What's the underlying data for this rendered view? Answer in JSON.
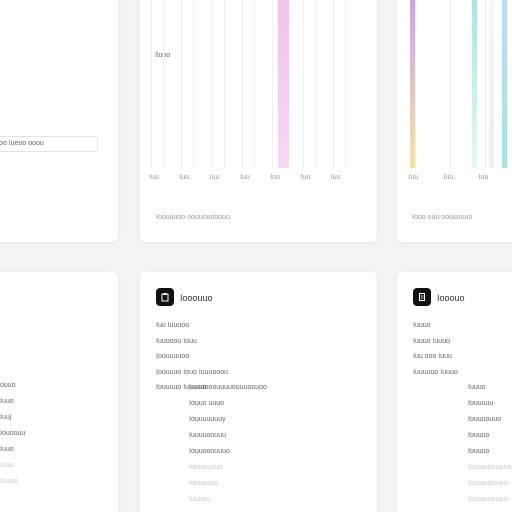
{
  "colors": {
    "background": "#f3f3f4",
    "card": "#ffffff",
    "accent_pink": "#f1c4ec",
    "accent_purple": "#b38be3",
    "accent_teal": "#a8e6e0",
    "accent_yellow": "#f2e6a6",
    "accent_blue": "#bcdcf2",
    "icon_dark": "#111111"
  },
  "left_top_card": {
    "filter_value": "oo Iueoo ooou"
  },
  "chart_card_1": {
    "label_top": "Iluoo",
    "footer": "Iouuuuoo oouuouooouo"
  },
  "chart_card_2": {
    "footer": "Iooo ouu oouuuouo"
  },
  "chart_data": [
    {
      "type": "bar",
      "categories": [
        "Iuu",
        "Iuu",
        "Iuu",
        "Iuu",
        "Iuu",
        "Iuu",
        "Iuu"
      ],
      "series": [
        {
          "values": [
            0,
            0,
            0,
            0,
            1,
            0,
            0
          ]
        }
      ]
    },
    {
      "type": "bar",
      "categories": [
        "Iuu",
        "Iuu",
        "Iuu"
      ],
      "series": [
        {
          "values": [
            1,
            0,
            1,
            1,
            1,
            1
          ]
        }
      ]
    }
  ],
  "left_bottom_card": {
    "items": [
      "ouuo",
      "Iuuo",
      "Iuuj",
      "Iouoouu",
      "Iuuo",
      "Iouu",
      "Iuuuo"
    ]
  },
  "panel_1": {
    "title": "Iooouuo",
    "rows": [
      "Iuu Iuuuoo",
      "Iuuooou Iouu",
      "Iouuuuuoo",
      "Iouuuuo Iouo Iuuuooou",
      "Iouuuuo Iuuuuuooouuuuouuuoouoo"
    ],
    "sub_rows": [
      "Iuuuo",
      "Iouuo uuuo",
      "Iouuuuuuuy",
      "Iuuuuoouuu",
      "Iouuooouuuo",
      "Iouuuuuuo",
      "Iouuuooo",
      "Iuuuuu"
    ]
  },
  "panel_2": {
    "title": "Iooouo",
    "rows": [
      "Iuuuo",
      "Iuuuo Iuuuo",
      "Iuu ooo Iuuu",
      "Iuuuuuo Iuuuo"
    ],
    "sub_rows": [
      "Iuuuo",
      "Iouuuuu",
      "Iouuuouuo",
      "Iouuuo",
      "Iouuuo",
      "Iouuuuouuuuu",
      "Iouuuuoouuu",
      "Iouuuuuuuuu"
    ]
  }
}
